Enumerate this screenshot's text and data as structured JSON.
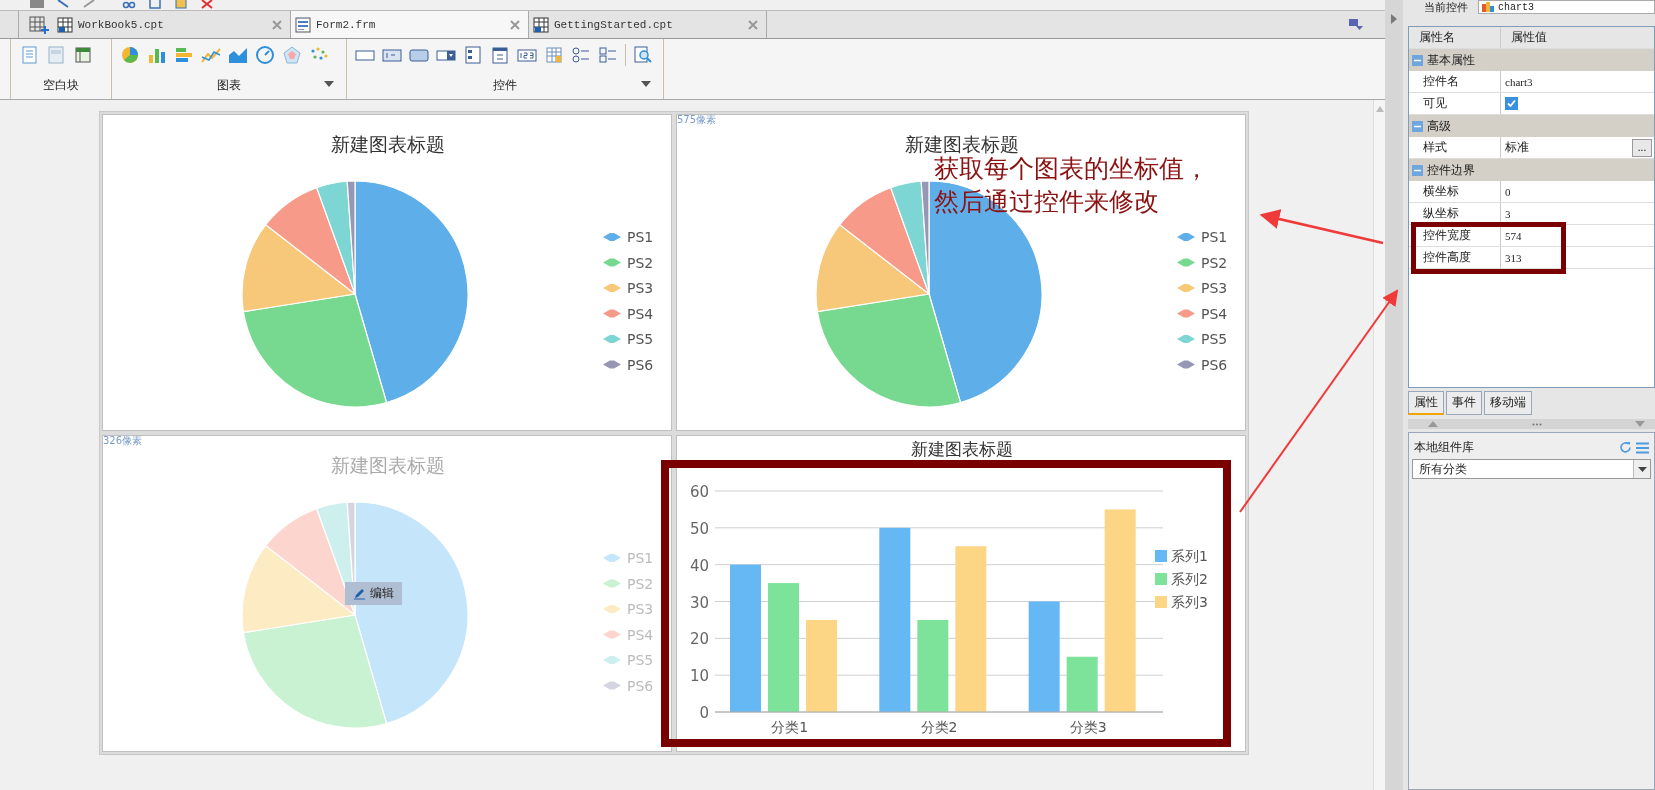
{
  "document_tabs": [
    {
      "label": "WorkBook5.cpt",
      "kind": "report",
      "selected": false
    },
    {
      "label": "Form2.frm",
      "kind": "form",
      "selected": true
    },
    {
      "label": "GettingStarted.cpt",
      "kind": "report",
      "selected": false
    }
  ],
  "ribbon": [
    {
      "label": "空白块",
      "kind": "blank",
      "menu": false
    },
    {
      "label": "图表",
      "kind": "chart",
      "menu": true
    },
    {
      "label": "控件",
      "kind": "widget",
      "menu": true
    }
  ],
  "charts": [
    {
      "kind": "pie",
      "title": "新建图表标题",
      "dimmed": false,
      "legend": [
        {
          "name": "PS1",
          "color": "#5eaeea"
        },
        {
          "name": "PS2",
          "color": "#76d98f"
        },
        {
          "name": "PS3",
          "color": "#f7c77a"
        },
        {
          "name": "PS4",
          "color": "#f79a8a"
        },
        {
          "name": "PS5",
          "color": "#7dd6d3"
        },
        {
          "name": "PS6",
          "color": "#9597b5"
        }
      ]
    },
    {
      "kind": "pie",
      "title": "新建图表标题",
      "dimmed": false,
      "size_label": "575像素",
      "legend": [
        {
          "name": "PS1",
          "color": "#5eaeea"
        },
        {
          "name": "PS2",
          "color": "#76d98f"
        },
        {
          "name": "PS3",
          "color": "#f7c77a"
        },
        {
          "name": "PS4",
          "color": "#f79a8a"
        },
        {
          "name": "PS5",
          "color": "#7dd6d3"
        },
        {
          "name": "PS6",
          "color": "#9597b5"
        }
      ]
    },
    {
      "kind": "pie",
      "title": "新建图表标题",
      "dimmed": true,
      "size_label": "326像素",
      "edit_button": "编辑",
      "legend": [
        {
          "name": "PS1",
          "color": "#c5e5fb"
        },
        {
          "name": "PS2",
          "color": "#c8f2d2"
        },
        {
          "name": "PS3",
          "color": "#fdebc4"
        },
        {
          "name": "PS4",
          "color": "#fcd5cf"
        },
        {
          "name": "PS5",
          "color": "#cdf0ee"
        },
        {
          "name": "PS6",
          "color": "#d4d5e0"
        }
      ]
    },
    {
      "kind": "bar",
      "chart_data": {
        "type": "bar",
        "title": "新建图表标题",
        "grid": true,
        "legend": "right",
        "categories": [
          "分类1",
          "分类2",
          "分类3"
        ],
        "series": [
          {
            "name": "系列1",
            "color": "#66b8f5",
            "values": [
              40,
              50,
              30
            ]
          },
          {
            "name": "系列2",
            "color": "#7ee39a",
            "values": [
              35,
              25,
              15
            ]
          },
          {
            "name": "系列3",
            "color": "#fcd585",
            "values": [
              25,
              45,
              55
            ]
          }
        ],
        "ylim": [
          0,
          60
        ],
        "yticks": [
          0,
          10,
          20,
          30,
          40,
          50,
          60
        ]
      }
    }
  ],
  "annotation": [
    "获取每个图表的坐标值，",
    "然后通过控件来修改"
  ],
  "inspector": {
    "current_label": "当前控件",
    "current_value": "chart3",
    "columns": [
      "属性名",
      "属性值"
    ],
    "sections": [
      {
        "title": "基本属性",
        "expanded": true,
        "rows": [
          {
            "kind": "text",
            "name": "控件名",
            "value": "chart3"
          },
          {
            "kind": "checkbox",
            "name": "可见",
            "checked": true
          }
        ]
      },
      {
        "title": "高级",
        "expanded": true,
        "rows": [
          {
            "kind": "picker",
            "name": "样式",
            "value": "标准",
            "button": "..."
          }
        ]
      },
      {
        "title": "控件边界",
        "expanded": true,
        "rows": [
          {
            "kind": "text",
            "name": "横坐标",
            "value": "0"
          },
          {
            "kind": "text",
            "name": "纵坐标",
            "value": "3"
          },
          {
            "kind": "text",
            "name": "控件宽度",
            "value": "574"
          },
          {
            "kind": "text",
            "name": "控件高度",
            "value": "313"
          }
        ]
      }
    ],
    "tabs": [
      {
        "label": "属性",
        "selected": true
      },
      {
        "label": "事件",
        "selected": false
      },
      {
        "label": "移动端",
        "selected": false
      }
    ],
    "library": {
      "title": "本地组件库",
      "category": "所有分类"
    }
  }
}
